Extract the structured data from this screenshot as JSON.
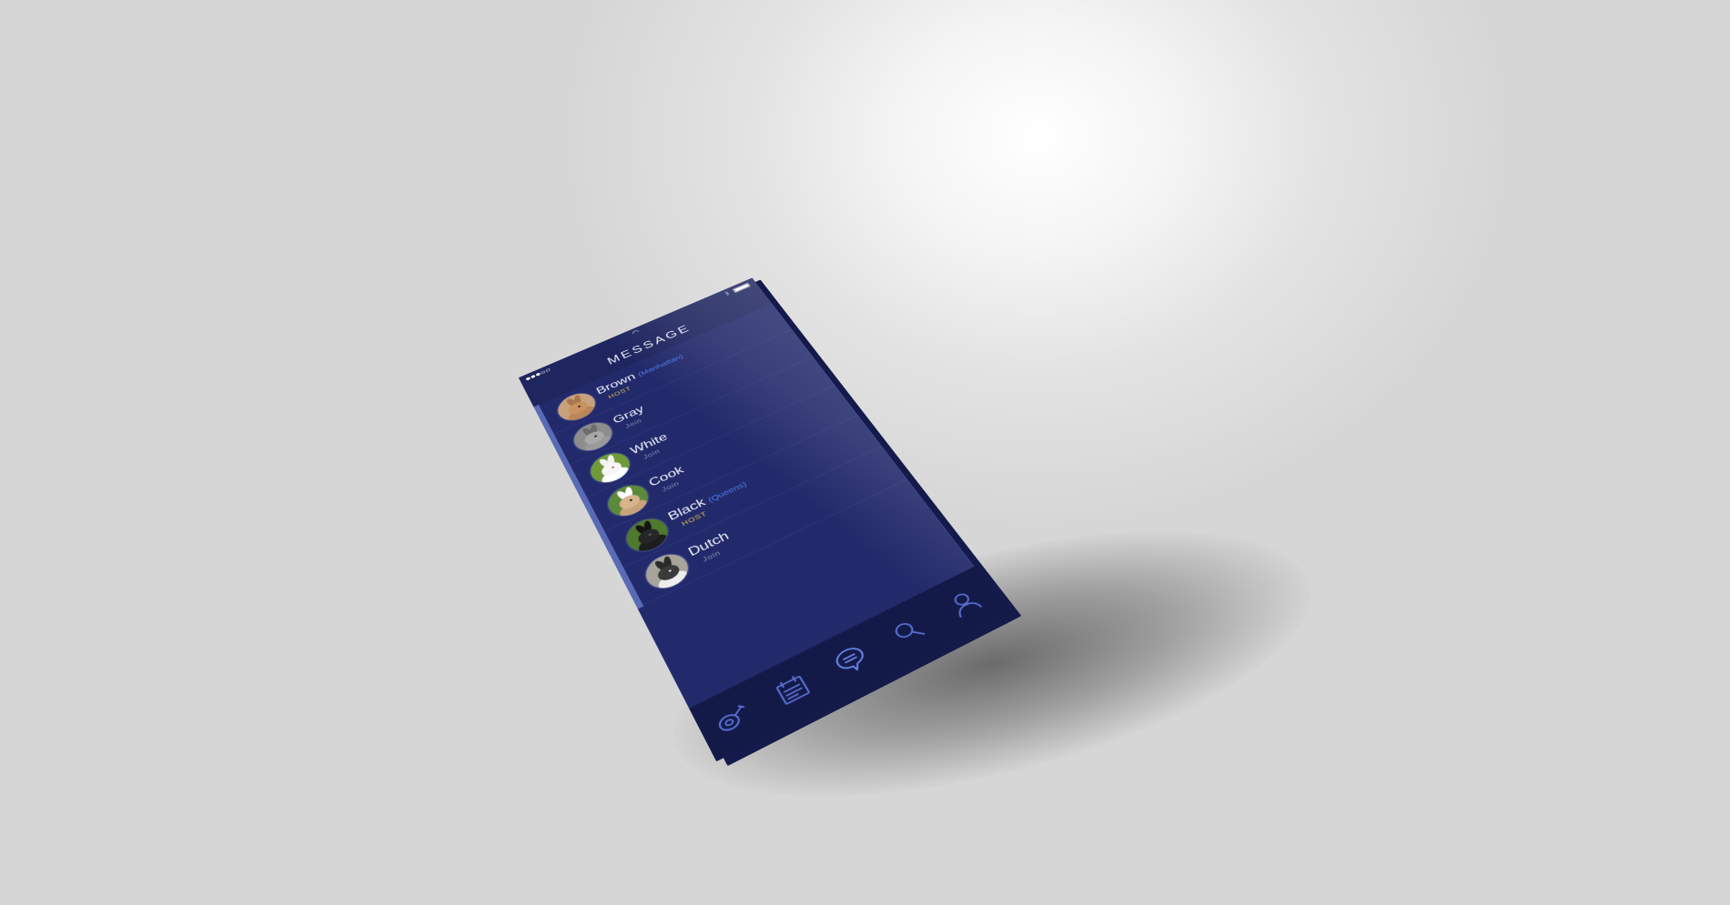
{
  "status_bar": {
    "signal_icon": "signal-dots-icon",
    "wifi_icon": "wifi-icon",
    "bluetooth_icon": "bluetooth-icon",
    "battery_icon": "battery-icon"
  },
  "header": {
    "title": "MESSAGE"
  },
  "contacts": [
    {
      "name": "Brown",
      "location": "(Manhattan)",
      "role": "HOST"
    },
    {
      "name": "Gray",
      "location": "",
      "role": "Join"
    },
    {
      "name": "White",
      "location": "",
      "role": "Join"
    },
    {
      "name": "Cook",
      "location": "",
      "role": "Join"
    },
    {
      "name": "Black",
      "location": "(Queens)",
      "role": "HOST"
    },
    {
      "name": "Dutch",
      "location": "",
      "role": "Join"
    }
  ],
  "tab_bar": {
    "tabs": [
      {
        "icon": "meat-icon"
      },
      {
        "icon": "calendar-icon"
      },
      {
        "icon": "chat-bubble-icon",
        "active": true
      },
      {
        "icon": "search-icon"
      },
      {
        "icon": "profile-icon"
      }
    ]
  },
  "colors": {
    "screen": "#232a6b",
    "header": "#1f255f",
    "accent_rail": "#5a6bb6",
    "host_text": "#d4bf4a",
    "location_text": "#4c7cf0",
    "tab_icon": "#5b72d8"
  }
}
